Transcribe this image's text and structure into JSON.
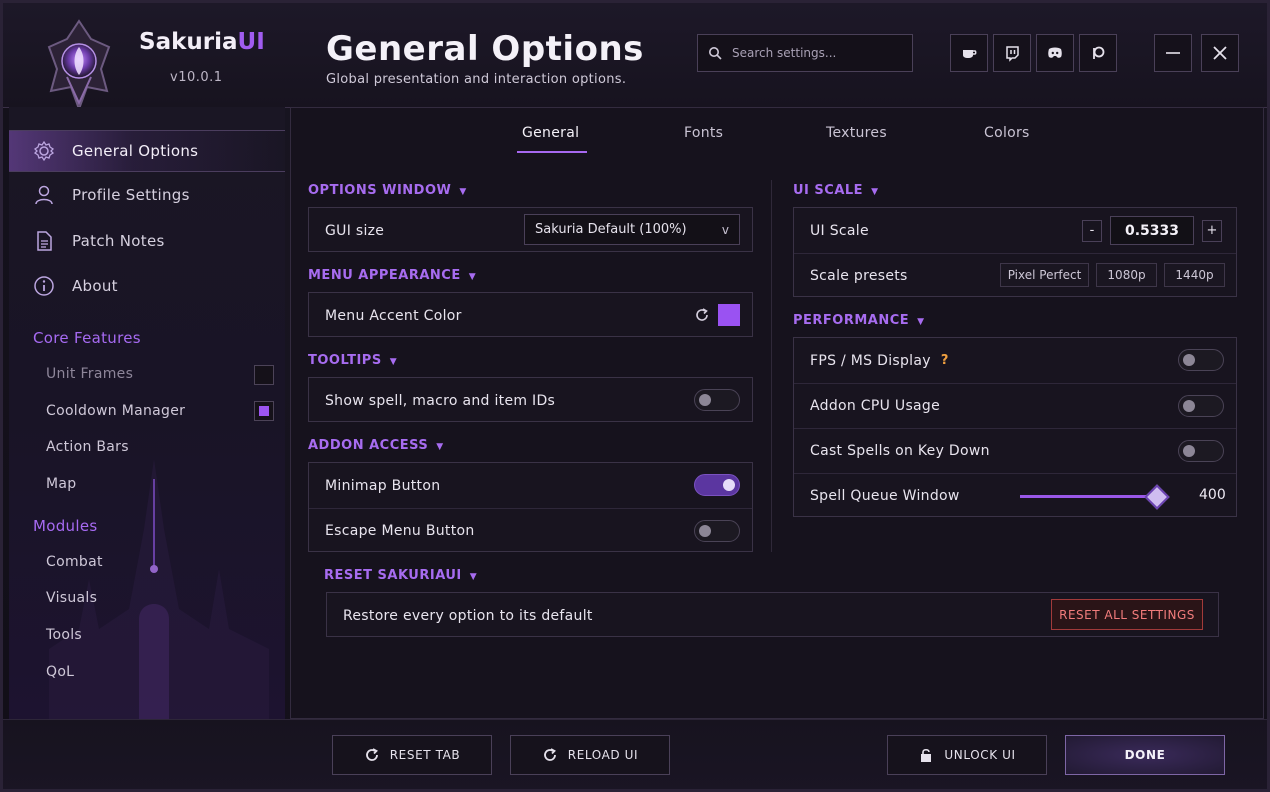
{
  "app": {
    "name_main": "Sakuria",
    "name_accent": "UI",
    "version": "v10.0.1"
  },
  "header": {
    "title": "General Options",
    "subtitle": "Global presentation and interaction options."
  },
  "search": {
    "placeholder": "Search settings..."
  },
  "header_icons": [
    "coffee-icon",
    "twitch-icon",
    "discord-icon",
    "patreon-icon",
    "minimize-icon",
    "close-icon"
  ],
  "sidebar": {
    "nav": [
      {
        "label": "General Options",
        "icon": "gear-icon"
      },
      {
        "label": "Profile Settings",
        "icon": "user-icon"
      },
      {
        "label": "Patch Notes",
        "icon": "document-icon"
      },
      {
        "label": "About",
        "icon": "info-icon"
      }
    ],
    "core_title": "Core Features",
    "core_items": [
      {
        "label": "Unit Frames",
        "checked": false
      },
      {
        "label": "Cooldown Manager",
        "checked": true
      },
      {
        "label": "Action Bars"
      },
      {
        "label": "Map"
      }
    ],
    "modules_title": "Modules",
    "module_items": [
      "Combat",
      "Visuals",
      "Tools",
      "QoL"
    ]
  },
  "tabs": [
    "General",
    "Fonts",
    "Textures",
    "Colors"
  ],
  "left": {
    "options_window": {
      "title": "OPTIONS WINDOW",
      "gui_label": "GUI size",
      "gui_value": "Sakuria Default (100%)",
      "gui_arrow": "v"
    },
    "menu_appearance": {
      "title": "MENU APPEARANCE",
      "accent_label": "Menu Accent Color",
      "accent_color": "#9a52f2"
    },
    "tooltips": {
      "title": "TOOLTIPS",
      "ids_label": "Show spell, macro and item IDs",
      "ids_on": false
    },
    "addon_access": {
      "title": "ADDON ACCESS",
      "minimap_label": "Minimap Button",
      "minimap_on": true,
      "escape_label": "Escape Menu Button",
      "escape_on": false
    }
  },
  "right": {
    "ui_scale": {
      "title": "UI SCALE",
      "scale_label": "UI Scale",
      "minus": "-",
      "value": "0.5333",
      "plus": "+",
      "presets_label": "Scale presets",
      "presets": [
        "Pixel Perfect",
        "1080p",
        "1440p"
      ]
    },
    "performance": {
      "title": "PERFORMANCE",
      "fps_label": "FPS / MS Display",
      "help": "?",
      "cpu_label": "Addon CPU Usage",
      "keydown_label": "Cast Spells on Key Down",
      "queue_label": "Spell Queue Window",
      "queue_value": "400",
      "queue_fraction": 0.94
    }
  },
  "reset": {
    "title": "RESET SAKURIAUI",
    "label": "Restore every option to its default",
    "button": "RESET ALL SETTINGS"
  },
  "footer": {
    "reset_tab": "RESET TAB",
    "reload_ui": "RELOAD UI",
    "unlock_ui": "UNLOCK UI",
    "done": "DONE"
  },
  "colors": {
    "accent": "#a05cf0",
    "danger": "#f27c7c"
  }
}
